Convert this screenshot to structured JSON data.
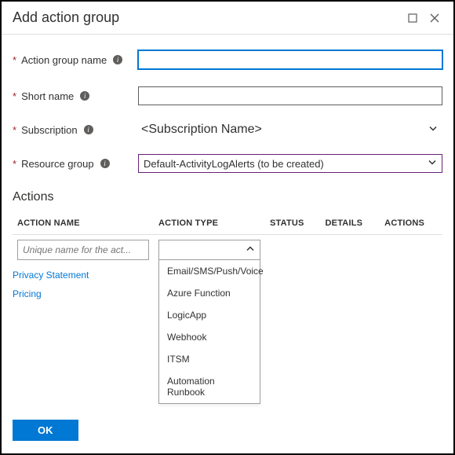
{
  "titlebar": {
    "title": "Add action group"
  },
  "fields": {
    "action_group_name": {
      "label": "Action group name",
      "value": ""
    },
    "short_name": {
      "label": "Short name",
      "value": ""
    },
    "subscription": {
      "label": "Subscription",
      "value": "<Subscription Name>"
    },
    "resource_group": {
      "label": "Resource group",
      "value": "Default-ActivityLogAlerts (to be created)"
    }
  },
  "actions_section": {
    "heading": "Actions",
    "columns": {
      "name": "ACTION NAME",
      "type": "ACTION TYPE",
      "status": "STATUS",
      "details": "DETAILS",
      "actions": "ACTIONS"
    },
    "row": {
      "name_placeholder": "Unique name for the act...",
      "type_value": "",
      "type_options": [
        "Email/SMS/Push/Voice",
        "Azure Function",
        "LogicApp",
        "Webhook",
        "ITSM",
        "Automation Runbook"
      ]
    }
  },
  "links": {
    "privacy": "Privacy Statement",
    "pricing": "Pricing"
  },
  "footer": {
    "ok": "OK"
  }
}
